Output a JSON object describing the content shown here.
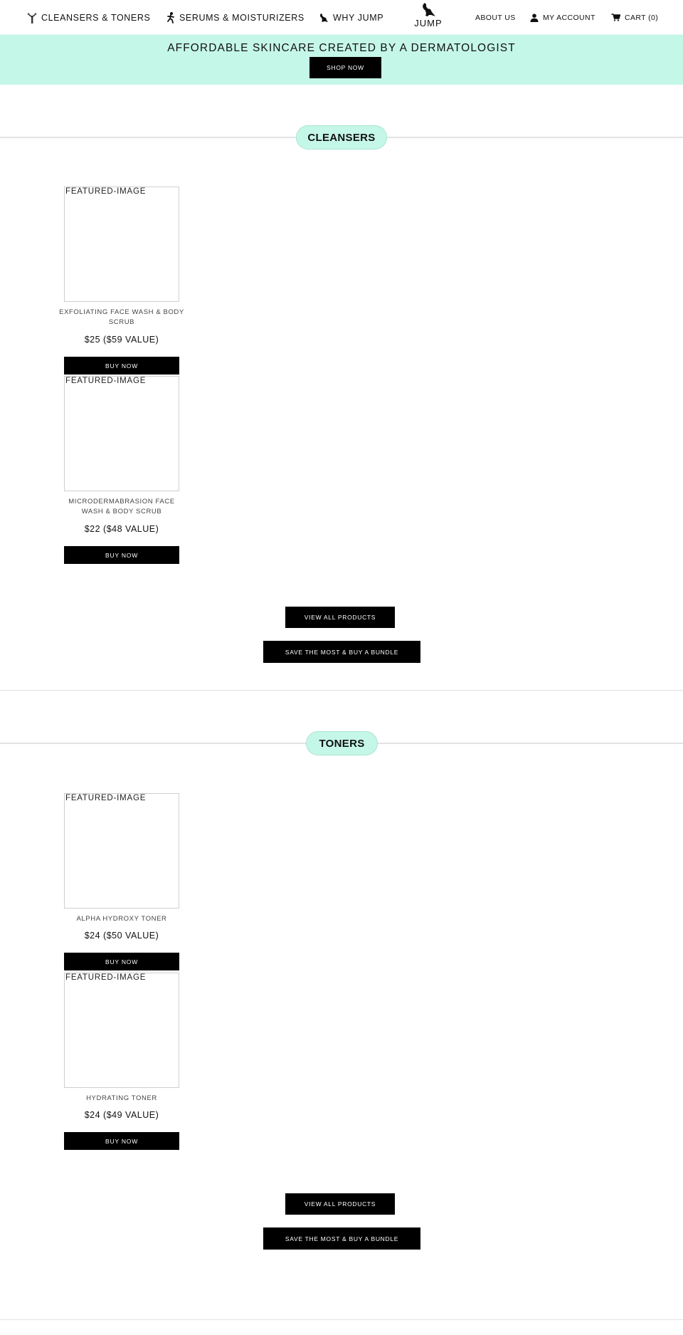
{
  "header": {
    "nav_left": [
      {
        "label": "CLEANSERS & TONERS",
        "icon": "bottle-icon"
      },
      {
        "label": "SERUMS & MOISTURIZERS",
        "icon": "runner-icon"
      },
      {
        "label": "WHY JUMP",
        "icon": "kangaroo-icon"
      }
    ],
    "logo_text": "JUMP",
    "nav_right": [
      {
        "label": "ABOUT US"
      },
      {
        "label": "MY ACCOUNT",
        "icon": "user-icon"
      },
      {
        "label": "CART (0)",
        "icon": "cart-icon"
      }
    ]
  },
  "promo": {
    "title": "AFFORDABLE SKINCARE CREATED BY A DERMATOLOGIST",
    "button": "SHOP NOW",
    "background": "#c5f7e8"
  },
  "sections": [
    {
      "title": "CLEANSERS",
      "products": [
        {
          "image_label": "FEATURED-IMAGE",
          "name": "EXFOLIATING FACE WASH & BODY SCRUB",
          "price": "$25 ($59 VALUE)",
          "button": "BUY NOW"
        },
        {
          "image_label": "FEATURED-IMAGE",
          "name": "MICRODERMABRASION FACE WASH & BODY SCRUB",
          "price": "$22 ($48 VALUE)",
          "button": "BUY NOW"
        }
      ],
      "view_all": "VIEW ALL PRODUCTS",
      "bundle": "SAVE THE MOST & BUY A BUNDLE"
    },
    {
      "title": "TONERS",
      "products": [
        {
          "image_label": "FEATURED-IMAGE",
          "name": "ALPHA HYDROXY TONER",
          "price": "$24 ($50 VALUE)",
          "button": "BUY NOW"
        },
        {
          "image_label": "FEATURED-IMAGE",
          "name": "HYDRATING TONER",
          "price": "$24 ($49 VALUE)",
          "button": "BUY NOW"
        }
      ],
      "view_all": "VIEW ALL PRODUCTS",
      "bundle": "SAVE THE MOST & BUY A BUNDLE"
    }
  ],
  "colors": {
    "accent_mint": "#c5f7e8",
    "button_black": "#000000"
  }
}
